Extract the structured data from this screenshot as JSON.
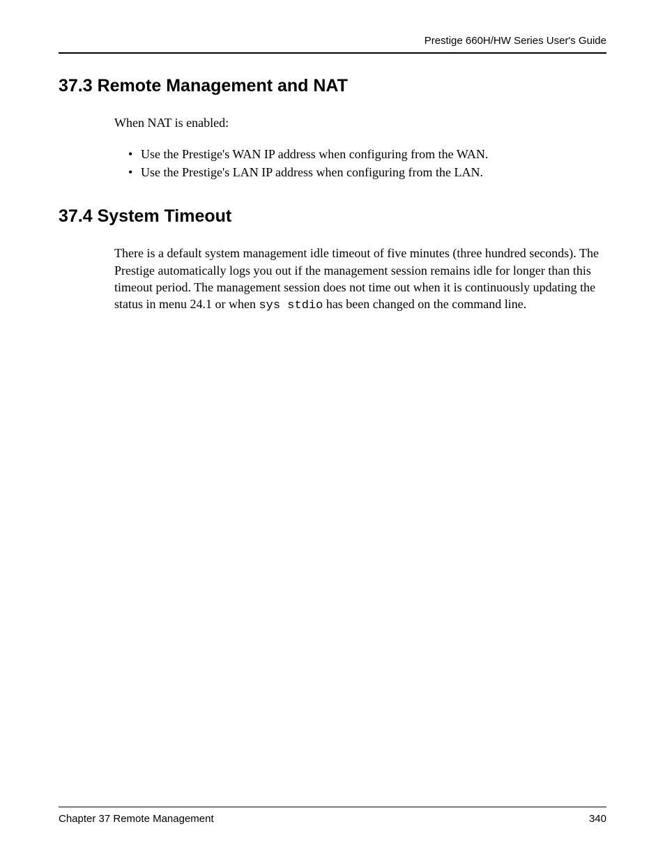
{
  "header": {
    "guide_title": "Prestige 660H/HW Series User's Guide"
  },
  "sections": {
    "s37_3": {
      "heading": "37.3  Remote Management and NAT",
      "intro": "When NAT is enabled:",
      "bullets": [
        "Use the Prestige's WAN IP address when configuring from the WAN.",
        "Use the Prestige's LAN IP address when configuring from the LAN."
      ]
    },
    "s37_4": {
      "heading": "37.4  System Timeout",
      "para_pre": "There is a default system management idle timeout of five minutes (three hundred seconds). The Prestige automatically logs you out if the management session remains idle for longer than this timeout period. The management session does not time out when it is continuously updating the status in menu 24.1 or when ",
      "para_code": "sys stdio",
      "para_post": " has been changed on the command line."
    }
  },
  "footer": {
    "chapter": "Chapter 37 Remote Management",
    "page_number": "340"
  }
}
